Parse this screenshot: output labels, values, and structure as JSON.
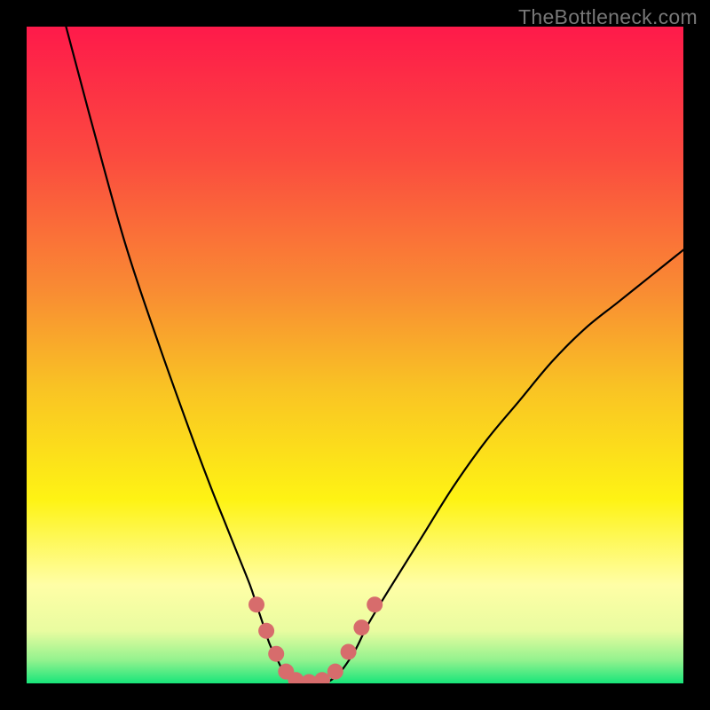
{
  "watermark": "TheBottleneck.com",
  "colors": {
    "frame": "#000000",
    "curve": "#000000",
    "marker": "#d76c6c",
    "gradient_stops": [
      {
        "offset": 0.0,
        "color": "#fe1a4a"
      },
      {
        "offset": 0.2,
        "color": "#fb4b3f"
      },
      {
        "offset": 0.4,
        "color": "#f98b33"
      },
      {
        "offset": 0.55,
        "color": "#f9c324"
      },
      {
        "offset": 0.72,
        "color": "#fef314"
      },
      {
        "offset": 0.85,
        "color": "#fffea6"
      },
      {
        "offset": 0.92,
        "color": "#e9fca0"
      },
      {
        "offset": 0.965,
        "color": "#92f28e"
      },
      {
        "offset": 1.0,
        "color": "#18e57a"
      }
    ]
  },
  "chart_data": {
    "type": "line",
    "title": "",
    "xlabel": "",
    "ylabel": "",
    "xlim": [
      0,
      100
    ],
    "ylim": [
      0,
      100
    ],
    "series": [
      {
        "name": "left-branch",
        "x": [
          6,
          10,
          15,
          20,
          25,
          28,
          30,
          32,
          34,
          35,
          36,
          37,
          38,
          39,
          40,
          41,
          42
        ],
        "y": [
          100,
          85,
          67,
          52,
          38,
          30,
          25,
          20,
          15,
          12,
          9,
          6,
          4,
          2,
          1,
          0.3,
          0
        ]
      },
      {
        "name": "right-branch",
        "x": [
          45,
          46,
          47,
          48,
          50,
          52,
          55,
          60,
          65,
          70,
          75,
          80,
          85,
          90,
          95,
          100
        ],
        "y": [
          0,
          0.3,
          1,
          2,
          5,
          9,
          14,
          22,
          30,
          37,
          43,
          49,
          54,
          58,
          62,
          66
        ]
      }
    ],
    "markers": {
      "name": "highlight-dots",
      "points": [
        {
          "x": 35.0,
          "y": 12.0
        },
        {
          "x": 36.5,
          "y": 8.0
        },
        {
          "x": 38.0,
          "y": 4.5
        },
        {
          "x": 39.5,
          "y": 1.8
        },
        {
          "x": 41.0,
          "y": 0.5
        },
        {
          "x": 43.0,
          "y": 0.2
        },
        {
          "x": 45.0,
          "y": 0.5
        },
        {
          "x": 47.0,
          "y": 1.8
        },
        {
          "x": 49.0,
          "y": 4.8
        },
        {
          "x": 51.0,
          "y": 8.5
        },
        {
          "x": 53.0,
          "y": 12.0
        }
      ]
    }
  }
}
